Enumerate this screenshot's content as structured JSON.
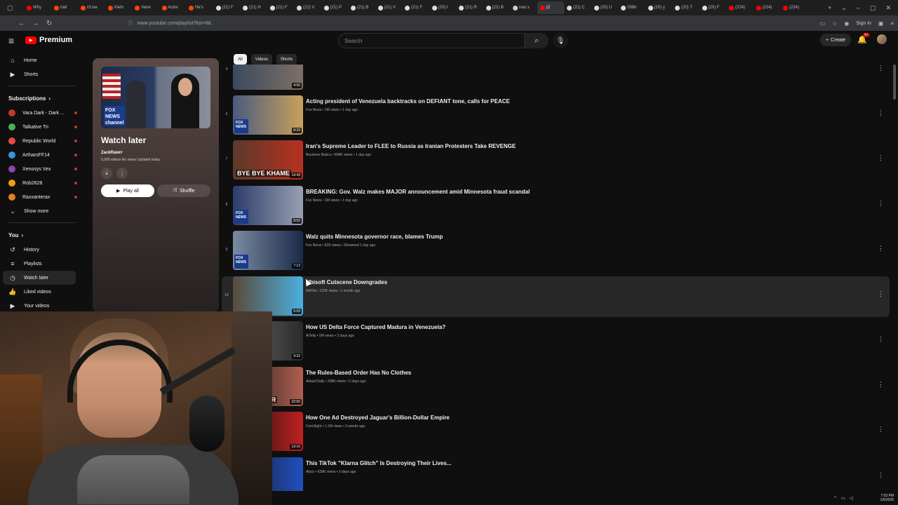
{
  "browser": {
    "tabs": [
      {
        "label": "Why",
        "color": "#ff0000"
      },
      {
        "label": "r/all",
        "color": "#ff4500"
      },
      {
        "label": "r/Live",
        "color": "#ff4500"
      },
      {
        "label": "Vietn",
        "color": "#ff4500"
      },
      {
        "label": "Vene",
        "color": "#ff4500"
      },
      {
        "label": "Activi",
        "color": "#ff4500"
      },
      {
        "label": "He's",
        "color": "#ff4500"
      },
      {
        "label": "(21) F",
        "color": "#dddddd"
      },
      {
        "label": "(21) H",
        "color": "#dddddd"
      },
      {
        "label": "(21) F",
        "color": "#dddddd"
      },
      {
        "label": "(21) V",
        "color": "#dddddd"
      },
      {
        "label": "(21) P",
        "color": "#dddddd"
      },
      {
        "label": "(21) B",
        "color": "#dddddd"
      },
      {
        "label": "(21) V",
        "color": "#dddddd"
      },
      {
        "label": "(21) F",
        "color": "#dddddd"
      },
      {
        "label": "(20) I",
        "color": "#dddddd"
      },
      {
        "label": "(21) R",
        "color": "#dddddd"
      },
      {
        "label": "(21) B",
        "color": "#dddddd"
      },
      {
        "label": "iran s",
        "color": "#cccccc"
      },
      {
        "label": "(2",
        "color": "#ff0000",
        "active": true
      },
      {
        "label": "(21) C",
        "color": "#dddddd"
      },
      {
        "label": "(20) U",
        "color": "#dddddd"
      },
      {
        "label": "098b",
        "color": "#dddddd"
      },
      {
        "label": "(20) y",
        "color": "#dddddd"
      },
      {
        "label": "(20) T",
        "color": "#dddddd"
      },
      {
        "label": "(20) F",
        "color": "#dddddd"
      },
      {
        "label": "(224)",
        "color": "#ff0000"
      },
      {
        "label": "(224)",
        "color": "#ff0000"
      },
      {
        "label": "(224)",
        "color": "#ff0000"
      }
    ],
    "url": "www.youtube.com/playlist?list=WL",
    "signin_label": "Sign in"
  },
  "masthead": {
    "logo_text": "Premium",
    "search_placeholder": "Search",
    "create_label": "Create",
    "notif_count": "9+"
  },
  "sidebar": {
    "top": [
      {
        "label": "Home",
        "icon": "home-icon",
        "glyph": "⌂"
      },
      {
        "label": "Shorts",
        "icon": "shorts-icon",
        "glyph": "▶"
      }
    ],
    "subs_header": "Subscriptions",
    "subs": [
      {
        "label": "Vara Dark - Dark ...",
        "color": "#c0392b"
      },
      {
        "label": "Talkative Tri",
        "color": "#4caf50"
      },
      {
        "label": "Republic World",
        "color": "#e74c3c"
      },
      {
        "label": "ArtharsFF14",
        "color": "#3498db"
      },
      {
        "label": "Xenosys Vex",
        "color": "#8e44ad"
      },
      {
        "label": "Rob2628",
        "color": "#f39c12"
      },
      {
        "label": "Raxxanterax",
        "color": "#e67e22"
      }
    ],
    "show_more": "Show more",
    "you_header": "You",
    "you": [
      {
        "label": "History",
        "icon": "history-icon",
        "glyph": "↺"
      },
      {
        "label": "Playlists",
        "icon": "playlists-icon",
        "glyph": "≡"
      },
      {
        "label": "Watch later",
        "icon": "watch-later-icon",
        "glyph": "◷",
        "selected": true
      },
      {
        "label": "Liked videos",
        "icon": "like-icon",
        "glyph": "👍"
      },
      {
        "label": "Your videos",
        "icon": "your-videos-icon",
        "glyph": "▶"
      }
    ]
  },
  "playlist": {
    "title": "Watch later",
    "owner": "ZackRawrr",
    "meta": "5,000 videos  No views  Updated today",
    "play_all": "Play all",
    "shuffle": "Shuffle",
    "fox_label": "FOX NEWS channel"
  },
  "chips": [
    "All",
    "Videos",
    "Shorts"
  ],
  "videos": [
    {
      "idx": "4",
      "title": "",
      "meta": "",
      "dur": "4:50",
      "thumb": [
        "#3b4a5e",
        "#7d6f66"
      ],
      "fox": false
    },
    {
      "idx": "6",
      "title": "Acting president of Venezuela backtracks on DEFIANT tone, calls for PEACE",
      "meta": "Fox News • 1M views • 1 day ago",
      "dur": "8:29",
      "thumb": [
        "#4a5a80",
        "#c9a15a"
      ],
      "fox": true
    },
    {
      "idx": "7",
      "title": "Iran's Supreme Leader to FLEE to Russia as Iranian Protesters Take REVENGE",
      "meta": "Business Basics • 868K views • 1 day ago",
      "dur": "14:49",
      "thumb": [
        "#5a3a2a",
        "#b83020"
      ],
      "fox": false,
      "caption": "BYE BYE KHAME"
    },
    {
      "idx": "8",
      "title": "BREAKING: Gov. Walz makes MAJOR announcement amid Minnesota fraud scandal",
      "meta": "Fox News • 1M views • 1 day ago",
      "dur": "8:50",
      "thumb": [
        "#2c3c6c",
        "#9aa0b0"
      ],
      "fox": true
    },
    {
      "idx": "9",
      "title": "Walz quits Minnesota governor race, blames Trump",
      "meta": "Fox News • 62K views • Streamed 1 day ago",
      "dur": "7:13",
      "thumb": [
        "#7a8aa0",
        "#1a2a4a"
      ],
      "fox": true
    },
    {
      "idx": "10",
      "title": "Ubisoft Cutscene Downgrades",
      "meta": "NikTek • 120K views • 1 month ago",
      "dur": "5:09",
      "thumb": [
        "#5a4a3a",
        "#4ab0e0"
      ],
      "fox": false,
      "hover": true
    },
    {
      "idx": "11",
      "title": "How US Delta Force Captured Madura in Venezuela?",
      "meta": "AiTelly • 5M views • 2 days ago",
      "dur": "9:32",
      "thumb": [
        "#6a6a6a",
        "#2a2a2a"
      ],
      "fox": false
    },
    {
      "idx": "12",
      "title": "The Rules-Based Order Has No Clothes",
      "meta": "Akkad Daily • 298K views • 2 days ago",
      "dur": "22:00",
      "thumb": [
        "#1a1a1a",
        "#b06050"
      ],
      "fox": false,
      "caption": "S ARE OVER"
    },
    {
      "idx": "13",
      "title": "How One Ad Destroyed Jaguar's Billion-Dollar Empire",
      "meta": "CoreSight • 1.1M views • 3 weeks ago",
      "dur": "13:16",
      "thumb": [
        "#111111",
        "#c02020"
      ],
      "fox": false,
      "caption": "SIBLE\""
    },
    {
      "idx": "14",
      "title": "This TikTok \"Klarna Glitch\" Is Destroying Their Lives...",
      "meta": "Alozy • 639K views • 3 days ago",
      "dur": "",
      "thumb": [
        "#1a1a2a",
        "#2050c0"
      ],
      "fox": false
    }
  ],
  "taskbar": {
    "time": "7:03 PM",
    "date": "1/6/2026"
  }
}
